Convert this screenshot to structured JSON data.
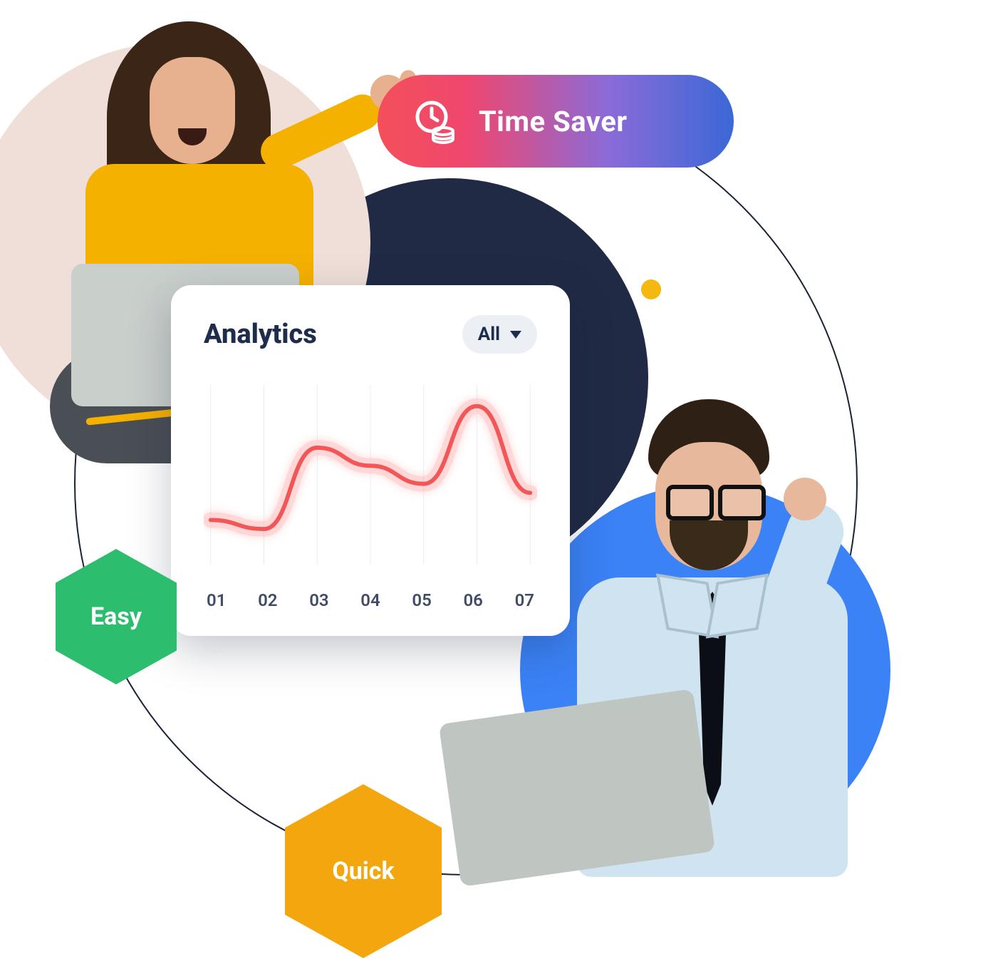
{
  "pill": {
    "label": "Time Saver",
    "icon": "clock-coins-icon"
  },
  "badges": {
    "easy": "Easy",
    "quick": "Quick"
  },
  "card": {
    "title": "Analytics",
    "dropdown": {
      "label": "All"
    }
  },
  "chart_data": {
    "type": "line",
    "categories": [
      "01",
      "02",
      "03",
      "04",
      "05",
      "06",
      "07"
    ],
    "values": [
      25,
      20,
      65,
      55,
      45,
      88,
      40
    ],
    "title": "Analytics",
    "xlabel": "",
    "ylabel": "",
    "ylim": [
      0,
      100
    ]
  },
  "colors": {
    "line": "#f25757",
    "glow": "#ffb8b8",
    "navy": "#1f2d4d",
    "green": "#2dbd6e",
    "orange": "#f4a60f",
    "blue": "#3b82f6"
  }
}
